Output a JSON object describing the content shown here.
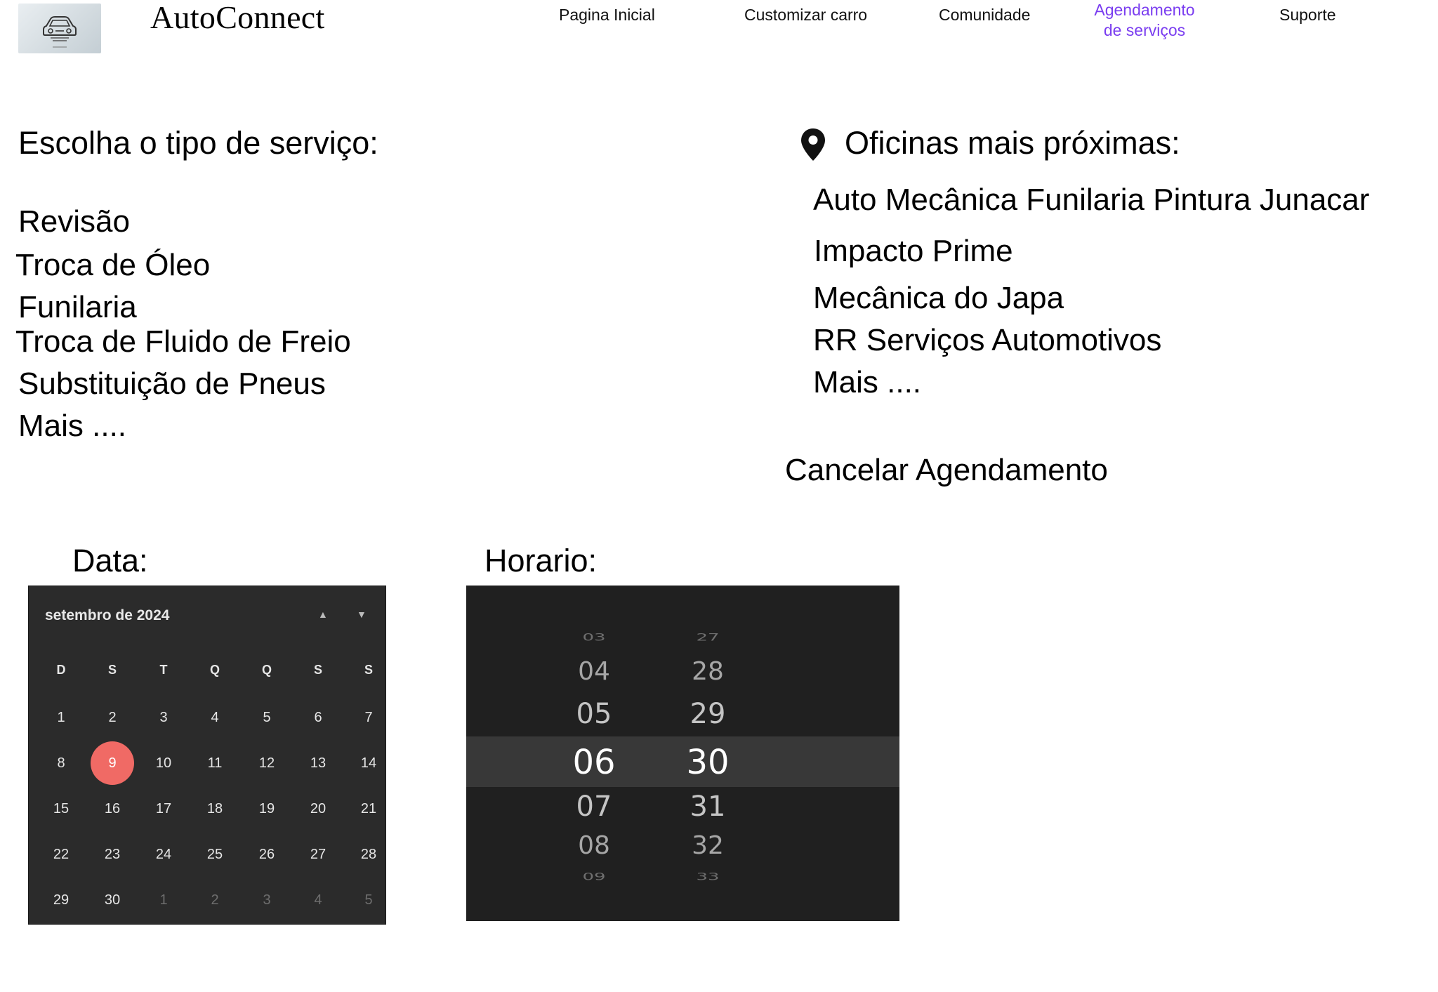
{
  "header": {
    "brand": "AutoConnect",
    "logo_icon": "car-icon",
    "nav": [
      "Pagina Inicial",
      "Customizar carro",
      "Comunidade",
      "Agendamento de serviços",
      "Suporte"
    ],
    "nav_active_color": "#7a3df0"
  },
  "services": {
    "heading": "Escolha o tipo de serviço:",
    "items": [
      "Revisão",
      "Troca de Óleo",
      "Funilaria",
      "Troca de Fluido de Freio",
      "Substituição de Pneus",
      "Mais ...."
    ]
  },
  "workshops": {
    "heading": "Oficinas mais próximas:",
    "icon": "location-pin-icon",
    "items": [
      "Auto Mecânica Funilaria Pintura Junacar",
      "Impacto Prime",
      "Mecânica do Japa",
      "RR Serviços Automotivos",
      "Mais ...."
    ]
  },
  "cancel_label": "Cancelar Agendamento",
  "date": {
    "label": "Data:",
    "month_title": "setembro de 2024",
    "weekdays": [
      "D",
      "S",
      "T",
      "Q",
      "Q",
      "S",
      "S"
    ],
    "weeks": [
      [
        "1",
        "2",
        "3",
        "4",
        "5",
        "6",
        "7"
      ],
      [
        "8",
        "9",
        "10",
        "11",
        "12",
        "13",
        "14"
      ],
      [
        "15",
        "16",
        "17",
        "18",
        "19",
        "20",
        "21"
      ],
      [
        "22",
        "23",
        "24",
        "25",
        "26",
        "27",
        "28"
      ],
      [
        "29",
        "30",
        "1",
        "2",
        "3",
        "4",
        "5"
      ]
    ],
    "selected_day": "9",
    "selected_color": "#f06a65"
  },
  "time": {
    "label": "Horario:",
    "hours": [
      "03",
      "04",
      "05",
      "06",
      "07",
      "08",
      "09"
    ],
    "minutes": [
      "27",
      "28",
      "29",
      "30",
      "31",
      "32",
      "33"
    ],
    "selected_hour": "06",
    "selected_minute": "30"
  }
}
